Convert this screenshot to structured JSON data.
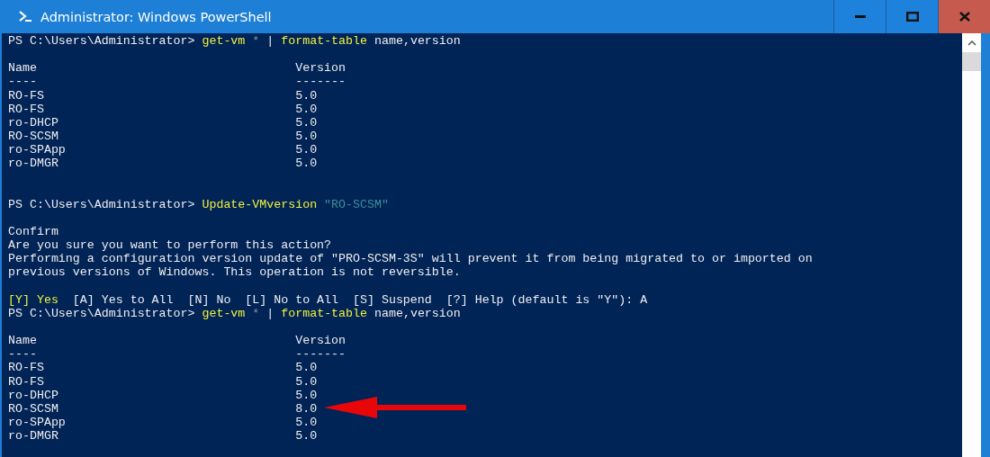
{
  "window": {
    "title": "Administrator: Windows PowerShell"
  },
  "console": {
    "lines": [
      {
        "kind": "text",
        "segments": [
          {
            "kind": "plain",
            "text": "PS C:\\Users\\Administrator> "
          },
          {
            "kind": "command",
            "text": "get-vm"
          },
          {
            "kind": "operator",
            "text": " * "
          },
          {
            "kind": "plain",
            "text": "| "
          },
          {
            "kind": "command",
            "text": "format-table"
          },
          {
            "kind": "plain",
            "text": " name,version"
          }
        ]
      },
      {
        "kind": "blank"
      },
      {
        "kind": "text",
        "segments": [
          {
            "kind": "plain",
            "text": "Name                                    Version"
          }
        ]
      },
      {
        "kind": "text",
        "segments": [
          {
            "kind": "plain",
            "text": "----                                    -------"
          }
        ]
      },
      {
        "kind": "text",
        "segments": [
          {
            "kind": "plain",
            "text": "RO-FS                                   5.0"
          }
        ]
      },
      {
        "kind": "text",
        "segments": [
          {
            "kind": "plain",
            "text": "RO-FS                                   5.0"
          }
        ]
      },
      {
        "kind": "text",
        "segments": [
          {
            "kind": "plain",
            "text": "ro-DHCP                                 5.0"
          }
        ]
      },
      {
        "kind": "text",
        "segments": [
          {
            "kind": "plain",
            "text": "RO-SCSM                                 5.0"
          }
        ]
      },
      {
        "kind": "text",
        "segments": [
          {
            "kind": "plain",
            "text": "ro-SPApp                                5.0"
          }
        ]
      },
      {
        "kind": "text",
        "segments": [
          {
            "kind": "plain",
            "text": "ro-DMGR                                 5.0"
          }
        ]
      },
      {
        "kind": "blank"
      },
      {
        "kind": "blank"
      },
      {
        "kind": "text",
        "segments": [
          {
            "kind": "plain",
            "text": "PS C:\\Users\\Administrator> "
          },
          {
            "kind": "command",
            "text": "Update-VMversion"
          },
          {
            "kind": "string",
            "text": " \"RO-SCSM\""
          }
        ]
      },
      {
        "kind": "blank"
      },
      {
        "kind": "text",
        "segments": [
          {
            "kind": "plain",
            "text": "Confirm"
          }
        ]
      },
      {
        "kind": "text",
        "segments": [
          {
            "kind": "plain",
            "text": "Are you sure you want to perform this action?"
          }
        ]
      },
      {
        "kind": "text",
        "segments": [
          {
            "kind": "plain",
            "text": "Performing a configuration version update of \"PRO-SCSM-3S\" will prevent it from being migrated to or imported on"
          }
        ]
      },
      {
        "kind": "text",
        "segments": [
          {
            "kind": "plain",
            "text": "previous versions of Windows. This operation is not reversible."
          }
        ]
      },
      {
        "kind": "blank"
      },
      {
        "kind": "text",
        "segments": [
          {
            "kind": "command",
            "text": "[Y] Yes"
          },
          {
            "kind": "plain",
            "text": "  [A] Yes to All  [N] No  [L] No to All  [S] Suspend  [?] Help (default is \"Y\"): A"
          }
        ]
      },
      {
        "kind": "text",
        "segments": [
          {
            "kind": "plain",
            "text": "PS C:\\Users\\Administrator> "
          },
          {
            "kind": "command",
            "text": "get-vm"
          },
          {
            "kind": "operator",
            "text": " * "
          },
          {
            "kind": "plain",
            "text": "| "
          },
          {
            "kind": "command",
            "text": "format-table"
          },
          {
            "kind": "plain",
            "text": " name,version"
          }
        ]
      },
      {
        "kind": "blank"
      },
      {
        "kind": "text",
        "segments": [
          {
            "kind": "plain",
            "text": "Name                                    Version"
          }
        ]
      },
      {
        "kind": "text",
        "segments": [
          {
            "kind": "plain",
            "text": "----                                    -------"
          }
        ]
      },
      {
        "kind": "text",
        "segments": [
          {
            "kind": "plain",
            "text": "RO-FS                                   5.0"
          }
        ]
      },
      {
        "kind": "text",
        "segments": [
          {
            "kind": "plain",
            "text": "RO-FS                                   5.0"
          }
        ]
      },
      {
        "kind": "text",
        "segments": [
          {
            "kind": "plain",
            "text": "ro-DHCP                                 5.0"
          }
        ]
      },
      {
        "kind": "text",
        "segments": [
          {
            "kind": "plain",
            "text": "RO-SCSM                                 8.0"
          }
        ]
      },
      {
        "kind": "text",
        "segments": [
          {
            "kind": "plain",
            "text": "ro-SPApp                                5.0"
          }
        ]
      },
      {
        "kind": "text",
        "segments": [
          {
            "kind": "plain",
            "text": "ro-DMGR                                 5.0"
          }
        ]
      }
    ]
  }
}
